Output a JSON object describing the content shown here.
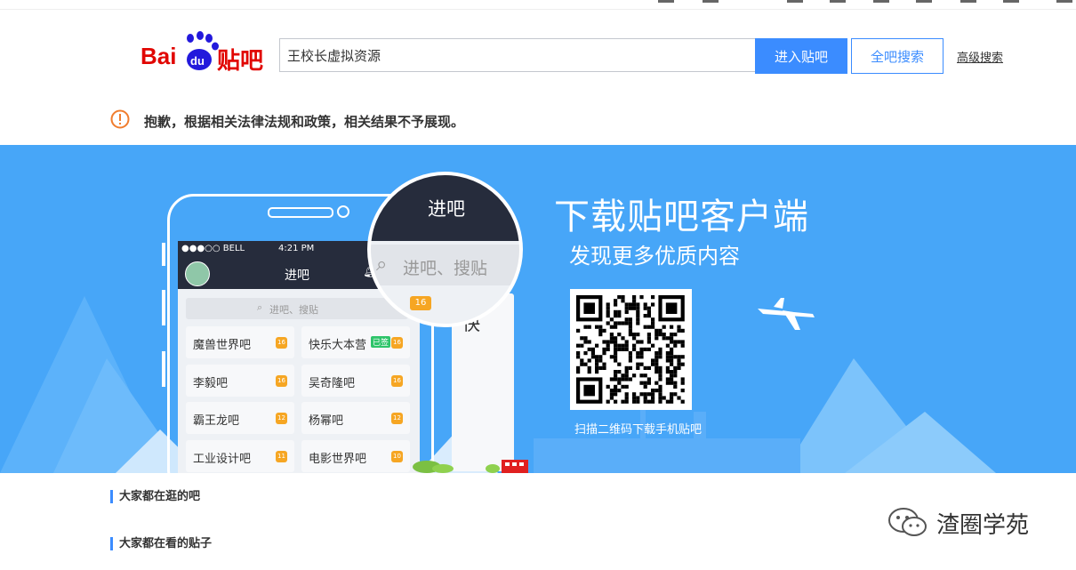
{
  "header": {
    "logo_text_bai": "Bai",
    "logo_text_du": "du",
    "logo_text_tieba": "贴吧",
    "search_value": "王校长虚拟资源",
    "enter_button": "进入贴吧",
    "search_all_button": "全吧搜索",
    "advanced_link": "高级搜索"
  },
  "notice": {
    "text": "抱歉，根据相关法律法规和政策，相关结果不予展现。"
  },
  "banner": {
    "title": "下载贴吧客户端",
    "subtitle": "发现更多优质内容",
    "qr_caption": "扫描二维码下载手机贴吧",
    "phone": {
      "carrier": "●●●○○ BELL",
      "time": "4:21 PM",
      "nav_title": "进吧",
      "search_placeholder": "进吧、搜贴",
      "tiles": [
        {
          "label": "魔兽世界吧",
          "badge": "16"
        },
        {
          "label": "快乐大本营",
          "badge": "16",
          "tag": "已签"
        },
        {
          "label": "李毅吧",
          "badge": "16"
        },
        {
          "label": "吴奇隆吧",
          "badge": "16"
        },
        {
          "label": "霸王龙吧",
          "badge": "12"
        },
        {
          "label": "杨幂吧",
          "badge": "12"
        },
        {
          "label": "工业设计吧",
          "badge": "11"
        },
        {
          "label": "电影世界吧",
          "badge": "10"
        }
      ]
    },
    "magnifier": {
      "title": "进吧",
      "search_placeholder": "进吧、搜贴",
      "badge": "16",
      "partial_char": "快"
    }
  },
  "sections": {
    "browsing": "大家都在逛的吧",
    "watching": "大家都在看的贴子"
  },
  "watermark": {
    "text": "渣圈学苑"
  },
  "colors": {
    "accent": "#3b8cff",
    "banner_bg": "#47a6f8",
    "warning": "#f07d2e",
    "baidu_red": "#e10602",
    "baidu_blue": "#2319dc"
  }
}
